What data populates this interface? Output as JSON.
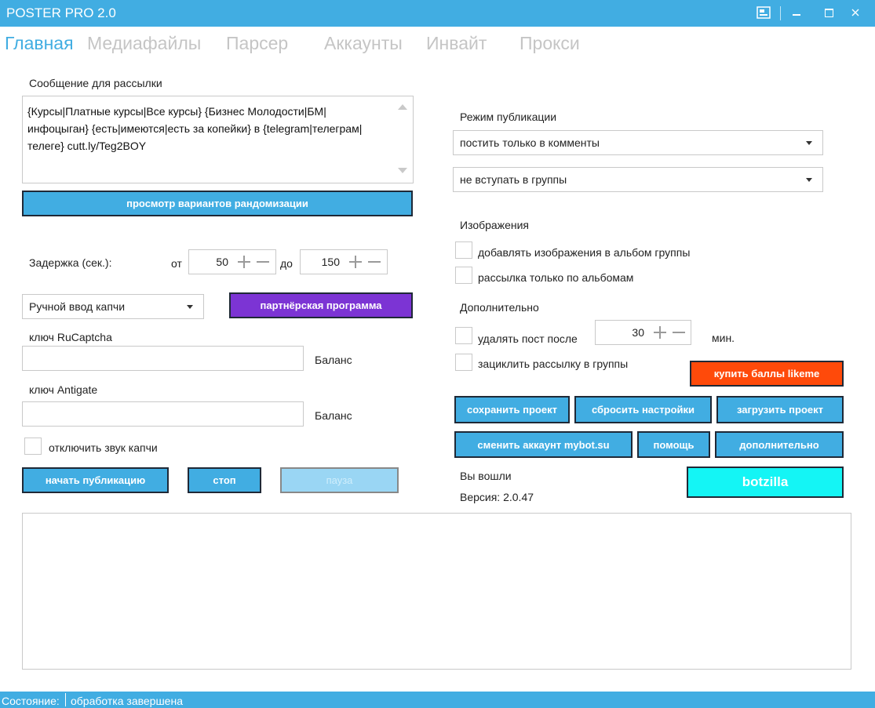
{
  "window": {
    "title": "POSTER PRO 2.0"
  },
  "tabs": [
    "Главная",
    "Медиафайлы",
    "Парсер",
    "Аккаунты",
    "Инвайт",
    "Прокси"
  ],
  "message": {
    "label": "Сообщение для рассылки",
    "text": "{Курсы|Платные курсы|Все курсы} {Бизнес Молодости|БМ|\nинфоцыган} {есть|имеются|есть за копейки} в {telegram|телеграм|\nтелеге} cutt.ly/Teg2BOY"
  },
  "buttons": {
    "randomize": "просмотр вариантов рандомизации",
    "partner": "партнёрская программа",
    "start": "начать публикацию",
    "stop": "стоп",
    "pause": "пауза",
    "buy_likeme": "купить баллы likeme",
    "save_project": "сохранить проект",
    "reset_settings": "сбросить настройки",
    "load_project": "загрузить проект",
    "change_account": "сменить аккаунт mybot.su",
    "help": "помощь",
    "more": "дополнительно",
    "botzilla": "botzilla"
  },
  "delay": {
    "label": "Задержка  (сек.):",
    "from_label": "от",
    "from_value": "50",
    "to_label": "до",
    "to_value": "150"
  },
  "captcha": {
    "mode": "Ручной ввод капчи",
    "rucaptcha_label": "ключ RuCaptcha",
    "rucaptcha_value": "",
    "antigate_label": "ключ Antigate",
    "antigate_value": "",
    "balance_label": "Баланс",
    "mute_label": "отключить звук капчи"
  },
  "publication": {
    "label": "Режим публикации",
    "mode": "постить только в комменты",
    "groups_mode": "не вступать в группы"
  },
  "images": {
    "label": "Изображения",
    "add_to_album": "добавлять изображения в альбом группы",
    "albums_only": "рассылка только по альбомам"
  },
  "extra": {
    "label": "Дополнительно",
    "delete_after": "удалять пост после",
    "delete_minutes": "30",
    "minutes_unit": "мин.",
    "loop": "зациклить рассылку в группы"
  },
  "info": {
    "logged_in": "Вы вошли",
    "version": "Версия: 2.0.47"
  },
  "status": {
    "label": "Состояние:",
    "value": "обработка завершена"
  },
  "colors": {
    "accent": "#41ade2",
    "purple": "#7c34d4",
    "orange": "#ff4a0a",
    "cyan": "#14f5f5"
  }
}
